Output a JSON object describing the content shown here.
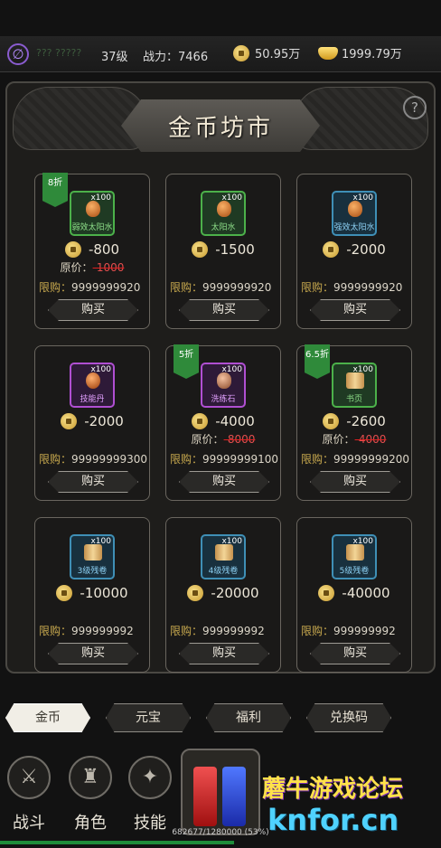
{
  "topbar": {
    "player_name": "???  ?????",
    "level": "37级",
    "power": "战力：7466",
    "coins": "50.95万",
    "ingots": "1999.79万"
  },
  "panel": {
    "title": "金币坊市",
    "help": "?"
  },
  "items": [
    {
      "name": "弱效太阳水",
      "qty": "x100",
      "price": "-800",
      "orig_label": "原价：",
      "orig_value": "-1000",
      "limit_label": "限购：",
      "limit_value": "9999999920",
      "buy": "购买",
      "badge": "8折",
      "tier": "green",
      "icon": "potion-icon"
    },
    {
      "name": "太阳水",
      "qty": "x100",
      "price": "-1500",
      "orig_label": "",
      "orig_value": "",
      "limit_label": "限购：",
      "limit_value": "9999999920",
      "buy": "购买",
      "badge": "",
      "tier": "green",
      "icon": "potion-icon"
    },
    {
      "name": "强效太阳水",
      "qty": "x100",
      "price": "-2000",
      "orig_label": "",
      "orig_value": "",
      "limit_label": "限购：",
      "limit_value": "9999999920",
      "buy": "购买",
      "badge": "",
      "tier": "blue",
      "icon": "potion-icon"
    },
    {
      "name": "技能丹",
      "qty": "x100",
      "price": "-2000",
      "orig_label": "",
      "orig_value": "",
      "limit_label": "限购：",
      "limit_value": "99999999300",
      "buy": "购买",
      "badge": "",
      "tier": "purple",
      "icon": "orb-icon"
    },
    {
      "name": "洗练石",
      "qty": "x100",
      "price": "-4000",
      "orig_label": "原价：",
      "orig_value": "-8000",
      "limit_label": "限购：",
      "limit_value": "99999999100",
      "buy": "购买",
      "badge": "5折",
      "tier": "purple",
      "icon": "stone-icon"
    },
    {
      "name": "书页",
      "qty": "x100",
      "price": "-2600",
      "orig_label": "原价：",
      "orig_value": "-4000",
      "limit_label": "限购：",
      "limit_value": "99999999200",
      "buy": "购买",
      "badge": "6.5折",
      "tier": "green",
      "icon": "scroll-icon"
    },
    {
      "name": "3级残卷",
      "qty": "x100",
      "price": "-10000",
      "orig_label": "",
      "orig_value": "",
      "limit_label": "限购：",
      "limit_value": "999999992",
      "buy": "购买",
      "badge": "",
      "tier": "blue",
      "icon": "scroll-icon"
    },
    {
      "name": "4级残卷",
      "qty": "x100",
      "price": "-20000",
      "orig_label": "",
      "orig_value": "",
      "limit_label": "限购：",
      "limit_value": "999999992",
      "buy": "购买",
      "badge": "",
      "tier": "blue",
      "icon": "scroll-icon"
    },
    {
      "name": "5级残卷",
      "qty": "x100",
      "price": "-40000",
      "orig_label": "",
      "orig_value": "",
      "limit_label": "限购：",
      "limit_value": "999999992",
      "buy": "购买",
      "badge": "",
      "tier": "blue",
      "icon": "scroll-icon"
    }
  ],
  "tabs": [
    "金币",
    "元宝",
    "福利",
    "兑换码"
  ],
  "nav": [
    "战斗",
    "角色",
    "技能"
  ],
  "exp": {
    "text": "682677/1280000 (53%)",
    "fraction": 0.53
  },
  "watermark": {
    "line1": "蘑牛游戏论坛",
    "line2": "knfor.cn"
  }
}
